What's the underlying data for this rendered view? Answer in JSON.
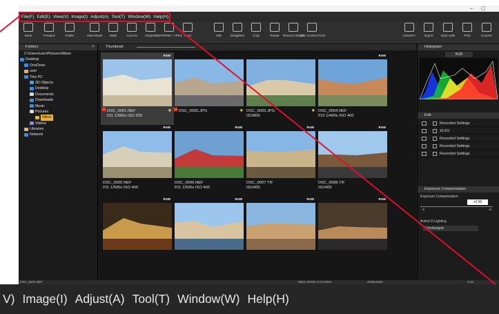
{
  "menu": [
    "File(F)",
    "Edit(E)",
    "View(V)",
    "Image(I)",
    "Adjust(A)",
    "Tool(T)",
    "Window(W)",
    "Help(H)"
  ],
  "window_controls": {
    "minimize": "–",
    "maximize": "▢"
  },
  "toolbar": {
    "left": [
      "Back",
      "Forward",
      "Folder"
    ],
    "view": [
      "View Mode",
      "Multi",
      "Current",
      "Original",
      "NEF/NRW + JPEG",
      "Dual"
    ],
    "edit": [
      "WB",
      "Straighten",
      "Crop",
      "Rotate",
      "Retouch Brush",
      "Color Control Point"
    ],
    "right": [
      "ViewNX-i",
      "Import",
      "Open with",
      "Print",
      "Convert"
    ]
  },
  "folders": {
    "title": "Folders",
    "path": "C:\\Users\\user\\Pictures\\Nikon",
    "items": [
      {
        "label": "Desktop",
        "color": "#3c8de0"
      },
      {
        "label": "OneDrive",
        "color": "#3c8de0"
      },
      {
        "label": "user",
        "color": "#d8b86a"
      },
      {
        "label": "This PC",
        "color": "#3c8de0"
      },
      {
        "label": "3D Objects",
        "color": "#4aa0e8"
      },
      {
        "label": "Desktop",
        "color": "#3c8de0"
      },
      {
        "label": "Documents",
        "color": "#d8d8d8"
      },
      {
        "label": "Downloads",
        "color": "#3c8de0"
      },
      {
        "label": "Music",
        "color": "#3c8de0"
      },
      {
        "label": "Pictures",
        "color": "#d8d8d8"
      },
      {
        "label": "Nikon",
        "color": "#e8b43a"
      },
      {
        "label": "Videos",
        "color": "#8a8ad8"
      },
      {
        "label": "Libraries",
        "color": "#d8b86a"
      },
      {
        "label": "Network",
        "color": "#3c8de0"
      }
    ]
  },
  "thumbnail_title": "Thumbnail",
  "raw_badge": "RAW",
  "thumbs": [
    {
      "l1": "DSC_0001.NEF",
      "l2": "f/11 1/500s ISO 200",
      "raw": true,
      "flag": true,
      "star": true,
      "sel": true
    },
    {
      "l1": "DSC_0002.JPG",
      "l2": "",
      "raw": false,
      "flag": true,
      "star": true,
      "sel": false
    },
    {
      "l1": "DSC_0003.JPG",
      "l2": "ISO800",
      "raw": false,
      "flag": false,
      "star": true,
      "sel": false
    },
    {
      "l1": "DSC_0004.NEF",
      "l2": "f/10 1/400s ISO 400",
      "raw": true,
      "flag": false,
      "star": false,
      "sel": false
    },
    {
      "l1": "DSC_0005.NEF",
      "l2": "f/11 1/500s ISO 400",
      "raw": true,
      "flag": false,
      "star": false,
      "sel": false
    },
    {
      "l1": "DSC_0006.NEF",
      "l2": "f/11 1/500s ISO 400",
      "raw": true,
      "flag": false,
      "star": false,
      "sel": false
    },
    {
      "l1": "DSC_0007.TIF",
      "l2": "ISO400",
      "raw": true,
      "flag": false,
      "star": false,
      "sel": false
    },
    {
      "l1": "DSC_0008.TIF",
      "l2": "ISO400",
      "raw": true,
      "flag": false,
      "star": false,
      "sel": false
    },
    {
      "l1": "",
      "l2": "",
      "raw": true,
      "flag": false,
      "star": false,
      "sel": false
    },
    {
      "l1": "",
      "l2": "",
      "raw": true,
      "flag": false,
      "star": false,
      "sel": false
    },
    {
      "l1": "",
      "l2": "",
      "raw": true,
      "flag": false,
      "star": false,
      "sel": false
    },
    {
      "l1": "",
      "l2": "",
      "raw": true,
      "flag": false,
      "star": false,
      "sel": false
    }
  ],
  "histogram": {
    "title": "Histogram",
    "channel": "RGB"
  },
  "edit_panel": {
    "title": "Edit",
    "rows": [
      "Recorded Settings",
      "±0 EV",
      "Recorded Settings",
      "Recorded Settings",
      "Recorded Settings"
    ]
  },
  "exposure": {
    "title": "Exposure Compensation",
    "label": "Exposure Compensation",
    "value": "+0.00",
    "minus": "-5",
    "plus": "+5"
  },
  "dlighting": {
    "label": "Active D-Lighting",
    "value": "Unchanged"
  },
  "status": {
    "file": "DSC_0001.NEF",
    "profile": "Nikon sRGB 4.0.0.3002",
    "dims": "4256x2832",
    "page": "1/15"
  },
  "zoom_text": [
    "V)",
    "Image(I)",
    "Adjust(A)",
    "Tool(T)",
    "Window(W)",
    "Help(H)"
  ],
  "colors": {
    "highlight": "#e0102a",
    "accent": "#e8b43a",
    "background": "#1e1e1e"
  }
}
